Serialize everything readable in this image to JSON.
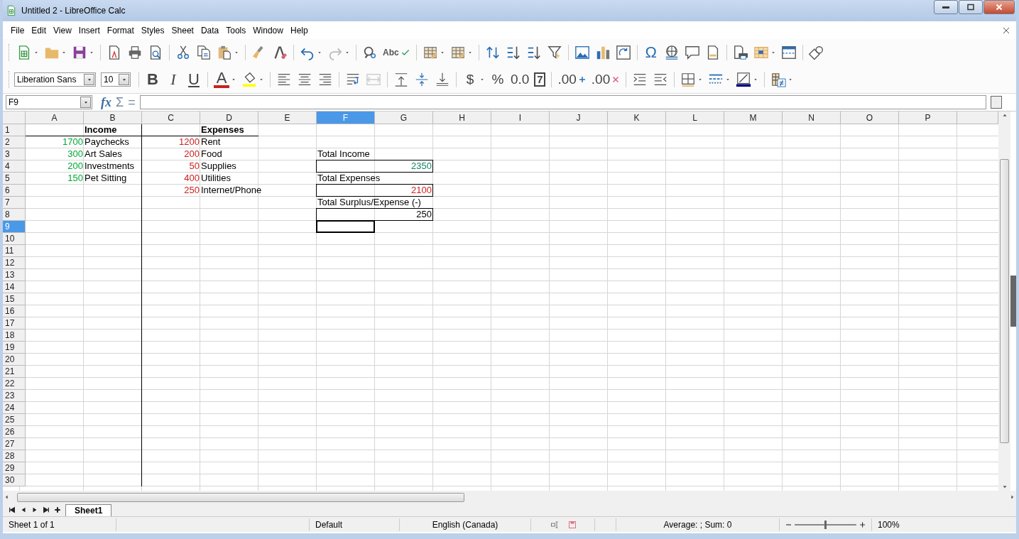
{
  "window": {
    "title": "Untitled 2 - LibreOffice Calc"
  },
  "menu": [
    "File",
    "Edit",
    "View",
    "Insert",
    "Format",
    "Styles",
    "Sheet",
    "Data",
    "Tools",
    "Window",
    "Help"
  ],
  "toolbars": {
    "standard": {
      "glyphs": [
        "Abc",
        "Ω"
      ]
    },
    "formatting": {
      "font_name": "Liberation Sans",
      "font_size": "10",
      "glyphs": [
        "B",
        "I",
        "U",
        "A",
        "$",
        "%",
        "0.0",
        "7",
        ".00",
        ".00"
      ]
    }
  },
  "formula_bar": {
    "name_box": "F9",
    "glyphs": [
      "fx",
      "Σ",
      "="
    ]
  },
  "sheet": {
    "columns": [
      {
        "label": "A",
        "selected": false,
        "rule_right": false
      },
      {
        "label": "B",
        "selected": false,
        "rule_right": true
      },
      {
        "label": "C",
        "selected": false,
        "rule_right": false
      },
      {
        "label": "D",
        "selected": false,
        "rule_right": false
      },
      {
        "label": "E",
        "selected": false,
        "rule_right": false
      },
      {
        "label": "F",
        "selected": true,
        "rule_right": false
      },
      {
        "label": "G",
        "selected": false,
        "rule_right": false
      },
      {
        "label": "H",
        "selected": false,
        "rule_right": false
      },
      {
        "label": "I",
        "selected": false,
        "rule_right": false
      },
      {
        "label": "J",
        "selected": false,
        "rule_right": false
      },
      {
        "label": "K",
        "selected": false,
        "rule_right": false
      },
      {
        "label": "L",
        "selected": false,
        "rule_right": false
      },
      {
        "label": "M",
        "selected": false,
        "rule_right": false
      },
      {
        "label": "N",
        "selected": false,
        "rule_right": false
      },
      {
        "label": "O",
        "selected": false,
        "rule_right": false
      },
      {
        "label": "P",
        "selected": false,
        "rule_right": false
      }
    ],
    "rows": [
      {
        "label": "1",
        "selected": false,
        "cells": [
          {
            "kind": "empty",
            "rule_bottom": true
          },
          {
            "kind": "text",
            "text": "Income",
            "bold": true,
            "rule_bottom": true
          },
          {
            "kind": "empty",
            "rule_bottom": true
          },
          {
            "kind": "text",
            "text": "Expenses",
            "bold": true,
            "rule_bottom": true
          }
        ]
      },
      {
        "label": "2",
        "selected": false,
        "cells": [
          {
            "kind": "number",
            "text": "1700",
            "color": "#00a933"
          },
          {
            "kind": "text",
            "text": "Paychecks"
          },
          {
            "kind": "number",
            "text": "1200",
            "color": "#c9211e"
          },
          {
            "kind": "text",
            "text": "Rent"
          }
        ]
      },
      {
        "label": "3",
        "selected": false,
        "cells": [
          {
            "kind": "number",
            "text": "300",
            "color": "#00a933"
          },
          {
            "kind": "text",
            "text": "Art Sales"
          },
          {
            "kind": "number",
            "text": "200",
            "color": "#c9211e"
          },
          {
            "kind": "text",
            "text": "Food"
          },
          {
            "kind": "empty"
          },
          {
            "kind": "text",
            "text": "Total Income"
          }
        ]
      },
      {
        "label": "4",
        "selected": false,
        "cells": [
          {
            "kind": "number",
            "text": "200",
            "color": "#00a933"
          },
          {
            "kind": "text",
            "text": "Investments"
          },
          {
            "kind": "number",
            "text": "50",
            "color": "#c9211e"
          },
          {
            "kind": "text",
            "text": "Supplies"
          },
          {
            "kind": "empty"
          },
          {
            "kind": "number",
            "text": "2350",
            "color": "#158466",
            "merged": true,
            "boxed": true
          }
        ]
      },
      {
        "label": "5",
        "selected": false,
        "cells": [
          {
            "kind": "number",
            "text": "150",
            "color": "#00a933"
          },
          {
            "kind": "text",
            "text": "Pet Sitting"
          },
          {
            "kind": "number",
            "text": "400",
            "color": "#c9211e"
          },
          {
            "kind": "text",
            "text": "Utilities"
          },
          {
            "kind": "empty"
          },
          {
            "kind": "text",
            "text": "Total Expenses"
          }
        ]
      },
      {
        "label": "6",
        "selected": false,
        "cells": [
          {
            "kind": "empty"
          },
          {
            "kind": "empty"
          },
          {
            "kind": "number",
            "text": "250",
            "color": "#c9211e"
          },
          {
            "kind": "text",
            "text": "Internet/Phone"
          },
          {
            "kind": "empty"
          },
          {
            "kind": "number",
            "text": "2100",
            "color": "#c9211e",
            "merged": true,
            "boxed": true
          }
        ]
      },
      {
        "label": "7",
        "selected": false,
        "cells": [
          {
            "kind": "empty"
          },
          {
            "kind": "empty"
          },
          {
            "kind": "empty"
          },
          {
            "kind": "empty"
          },
          {
            "kind": "empty"
          },
          {
            "kind": "text",
            "text": "Total Surplus/Expense (-)"
          }
        ]
      },
      {
        "label": "8",
        "selected": false,
        "cells": [
          {
            "kind": "empty"
          },
          {
            "kind": "empty"
          },
          {
            "kind": "empty"
          },
          {
            "kind": "empty"
          },
          {
            "kind": "empty"
          },
          {
            "kind": "number",
            "text": "250",
            "merged": true,
            "boxed": true
          }
        ]
      },
      {
        "label": "9",
        "selected": true
      },
      {
        "label": "10",
        "selected": false
      },
      {
        "label": "11",
        "selected": false
      },
      {
        "label": "12",
        "selected": false
      },
      {
        "label": "13",
        "selected": false
      },
      {
        "label": "14",
        "selected": false
      },
      {
        "label": "15",
        "selected": false
      },
      {
        "label": "16",
        "selected": false
      },
      {
        "label": "17",
        "selected": false
      },
      {
        "label": "18",
        "selected": false
      },
      {
        "label": "19",
        "selected": false
      },
      {
        "label": "20",
        "selected": false
      },
      {
        "label": "21",
        "selected": false
      },
      {
        "label": "22",
        "selected": false
      },
      {
        "label": "23",
        "selected": false
      },
      {
        "label": "24",
        "selected": false
      },
      {
        "label": "25",
        "selected": false
      },
      {
        "label": "26",
        "selected": false
      },
      {
        "label": "27",
        "selected": false
      },
      {
        "label": "28",
        "selected": false
      },
      {
        "label": "29",
        "selected": false
      },
      {
        "label": "30",
        "selected": false
      }
    ]
  },
  "sheet_tabs": [
    {
      "label": "Sheet1",
      "selected": true
    }
  ],
  "status_bar": {
    "sheet": "Sheet 1 of 1",
    "page_style": "Default",
    "language": "English (Canada)",
    "summary": "Average: ; Sum: 0",
    "zoom": {
      "level": 0.49
    },
    "zoom_reading": "100%"
  }
}
